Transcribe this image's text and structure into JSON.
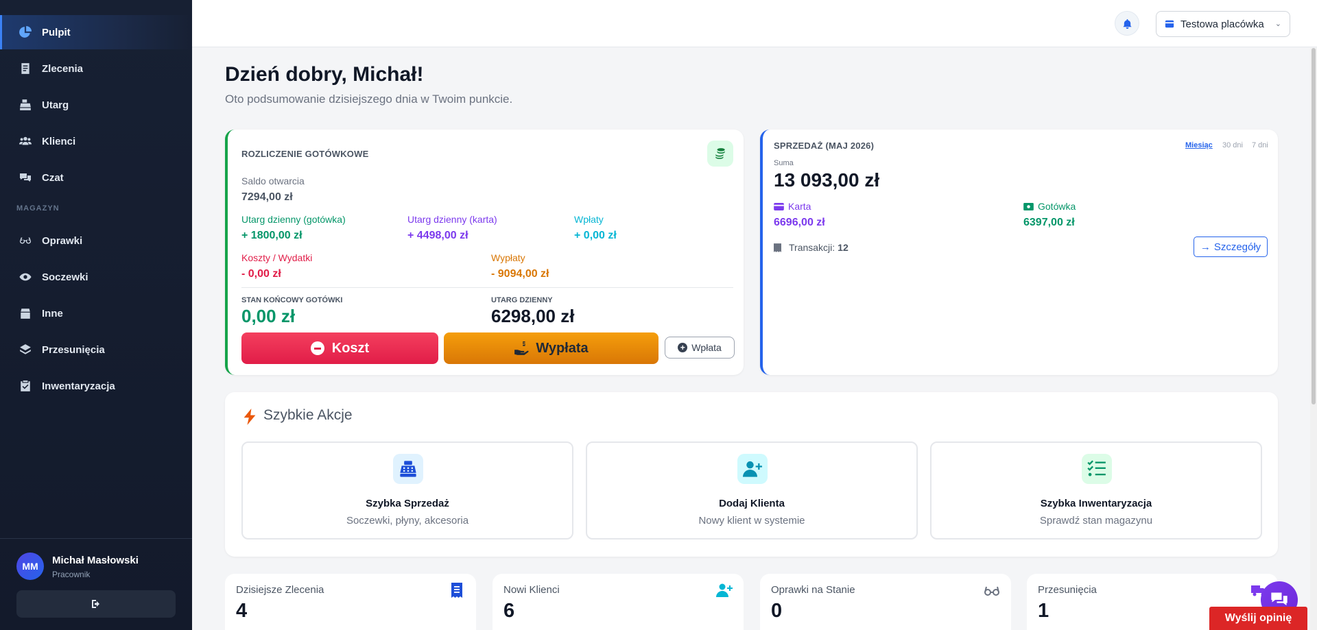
{
  "sidebar": {
    "items": [
      {
        "label": "Pulpit",
        "icon": "chart-pie-icon",
        "active": true
      },
      {
        "label": "Zlecenia",
        "icon": "document-icon"
      },
      {
        "label": "Utarg",
        "icon": "cash-register-icon"
      },
      {
        "label": "Klienci",
        "icon": "users-icon"
      },
      {
        "label": "Czat",
        "icon": "chat-icon"
      }
    ],
    "section_label": "MAGAZYN",
    "warehouse_items": [
      {
        "label": "Oprawki",
        "icon": "glasses-icon"
      },
      {
        "label": "Soczewki",
        "icon": "eye-icon"
      },
      {
        "label": "Inne",
        "icon": "box-icon"
      },
      {
        "label": "Przesunięcia",
        "icon": "layers-icon"
      },
      {
        "label": "Inwentaryzacja",
        "icon": "clipboard-icon"
      }
    ],
    "user": {
      "initials": "MM",
      "name": "Michał Masłowski",
      "role": "Pracownik"
    }
  },
  "header": {
    "store": "Testowa placówka"
  },
  "greeting": {
    "title": "Dzień dobry, Michał!",
    "subtitle": "Oto podsumowanie dzisiejszego dnia w Twoim punkcie."
  },
  "cash": {
    "title": "ROZLICZENIE GOTÓWKOWE",
    "opening_label": "Saldo otwarcia",
    "opening_value": "7294,00 zł",
    "cash_income_label": "Utarg dzienny (gotówka)",
    "cash_income_value": "+ 1800,00 zł",
    "card_income_label": "Utarg dzienny (karta)",
    "card_income_value": "+ 4498,00 zł",
    "deposits_label": "Wpłaty",
    "deposits_value": "+ 0,00 zł",
    "costs_label": "Koszty / Wydatki",
    "costs_value": "- 0,00 zł",
    "payouts_label": "Wypłaty",
    "payouts_value": "- 9094,00 zł",
    "end_label": "STAN KOŃCOWY GOTÓWKI",
    "end_value": "0,00 zł",
    "daily_label": "UTARG DZIENNY",
    "daily_value": "6298,00 zł",
    "btn_cost": "Koszt",
    "btn_payout": "Wypłata",
    "btn_deposit": "Wpłata",
    "colors": {
      "green": "#059669",
      "purple": "#7c3aed",
      "teal": "#0891b2",
      "red": "#e11d48",
      "orange": "#d97706"
    }
  },
  "sales": {
    "title": "SPRZEDAŻ (MAJ 2026)",
    "tabs": [
      "Miesiąc",
      "30 dni",
      "7 dni"
    ],
    "sum_label": "Suma",
    "sum_value": "13 093,00 zł",
    "card_label": "Karta",
    "card_value": "6696,00 zł",
    "cash_label": "Gotówka",
    "cash_value": "6397,00 zł",
    "transactions_label": "Transakcji:",
    "transactions_value": "12",
    "details_button": "Szczegóły"
  },
  "quick_actions": {
    "title": "Szybkie Akcje",
    "items": [
      {
        "name": "Szybka Sprzedaż",
        "desc": "Soczewki, płyny, akcesoria",
        "icon": "cash-register-icon"
      },
      {
        "name": "Dodaj Klienta",
        "desc": "Nowy klient w systemie",
        "icon": "user-plus-icon"
      },
      {
        "name": "Szybka Inwentaryzacja",
        "desc": "Sprawdź stan magazynu",
        "icon": "list-check-icon"
      }
    ]
  },
  "stats": [
    {
      "label": "Dzisiejsze Zlecenia",
      "value": "4",
      "icon": "receipt-icon"
    },
    {
      "label": "Nowi Klienci",
      "value": "6",
      "icon": "user-plus-icon"
    },
    {
      "label": "Oprawki na Stanie",
      "value": "0",
      "icon": "glasses-icon"
    },
    {
      "label": "Przesunięcia",
      "value": "1",
      "icon": "truck-icon"
    }
  ],
  "feedback_button": "Wyślij opinię"
}
